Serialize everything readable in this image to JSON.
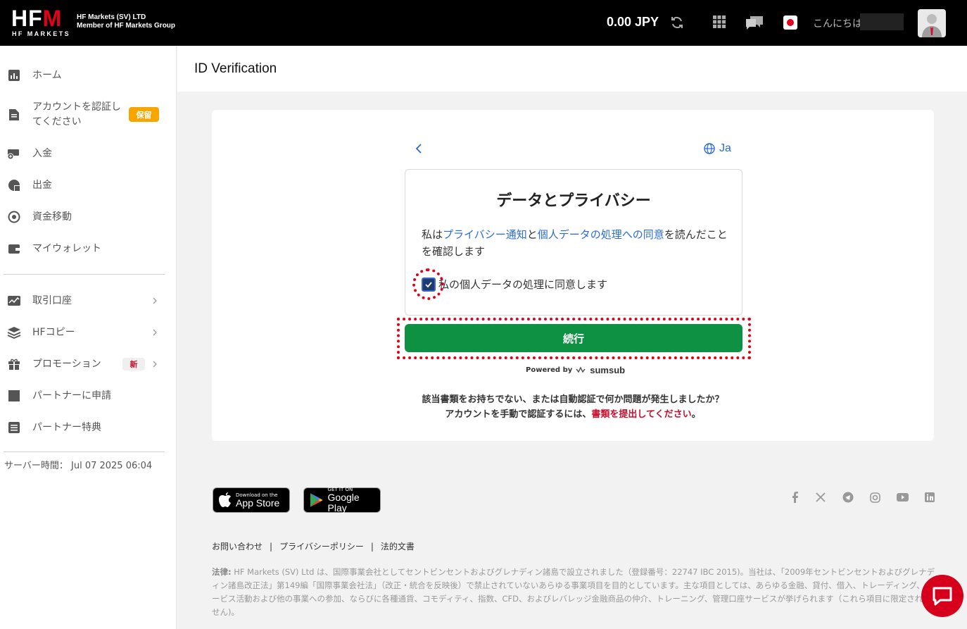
{
  "header": {
    "logo_text": "HF",
    "logo_m": "M",
    "logo_sub": "HF MARKETS",
    "company_line1": "HF Markets (SV) LTD",
    "company_line2": "Member of HF Markets Group",
    "balance": "0.00 JPY",
    "greeting": "こんにちは"
  },
  "sidebar": {
    "items": [
      {
        "label": "ホーム"
      },
      {
        "label": "アカウントを認証してください",
        "badge": "保留"
      },
      {
        "label": "入金"
      },
      {
        "label": "出金"
      },
      {
        "label": "資金移動"
      },
      {
        "label": "マイウォレット"
      },
      {
        "label": "取引口座"
      },
      {
        "label": "HFコピー"
      },
      {
        "label": "プロモーション",
        "badge": "新"
      },
      {
        "label": "パートナーに申請"
      },
      {
        "label": "パートナー特典"
      }
    ],
    "server_time": "サーバー時間： Jul 07 2025 06:04"
  },
  "main": {
    "page_title": "ID Verification",
    "language": "Ja",
    "privacy": {
      "title": "データとプライバシー",
      "text_prefix": "私は",
      "link1": "プライバシー通知",
      "text_mid": "と",
      "link2": "個人データの処理への同意",
      "text_suffix": "を読んだことを確認します",
      "consent": "私の個人データの処理に同意します"
    },
    "continue_label": "続行",
    "powered_by": "Powered by",
    "powered_brand": "sumsub",
    "help_line1": "該当書類をお持ちでない、または自動認証で何か問題が発生しましたか？",
    "help_line2_prefix": "アカウントを手動で認証するには、",
    "help_line2_link": "書類を提出してください",
    "help_line2_suffix": "。"
  },
  "footer": {
    "appstore_small": "Download on the",
    "appstore_big": "App Store",
    "googleplay_small": "GET IT ON",
    "googleplay_big": "Google Play",
    "links": [
      "お問い合わせ",
      "プライバシーポリシー",
      "法的文書"
    ],
    "legal_label": "法律:",
    "legal_text": " HF Markets (SV) Ltd は、国際事業会社としてセントビンセントおよびグレナディン諸島で設立されました（登録番号：22747 IBC 2015)。当社は、「2009年セントビンセントおよびグレナディン諸島改正法」第149編「国際事業会社法」（改正・統合を反映後）で禁止されていないあらゆる事業項目を目的としています。主な項目としては、あらゆる金融、貸付、借入、トレーディング、サービス活動および他の事業への参加、ならびに各種通貨、コモディティ、指数、CFD、およびレバレッジ金融商品の仲介、トレーニング、管理口座サービスが挙げられます（これら項目に限定されません)。"
  },
  "colors": {
    "accent_red": "#e3001b",
    "link_blue": "#2a6bd6",
    "continue_green": "#0f9144",
    "badge_orange": "#f7a600"
  }
}
